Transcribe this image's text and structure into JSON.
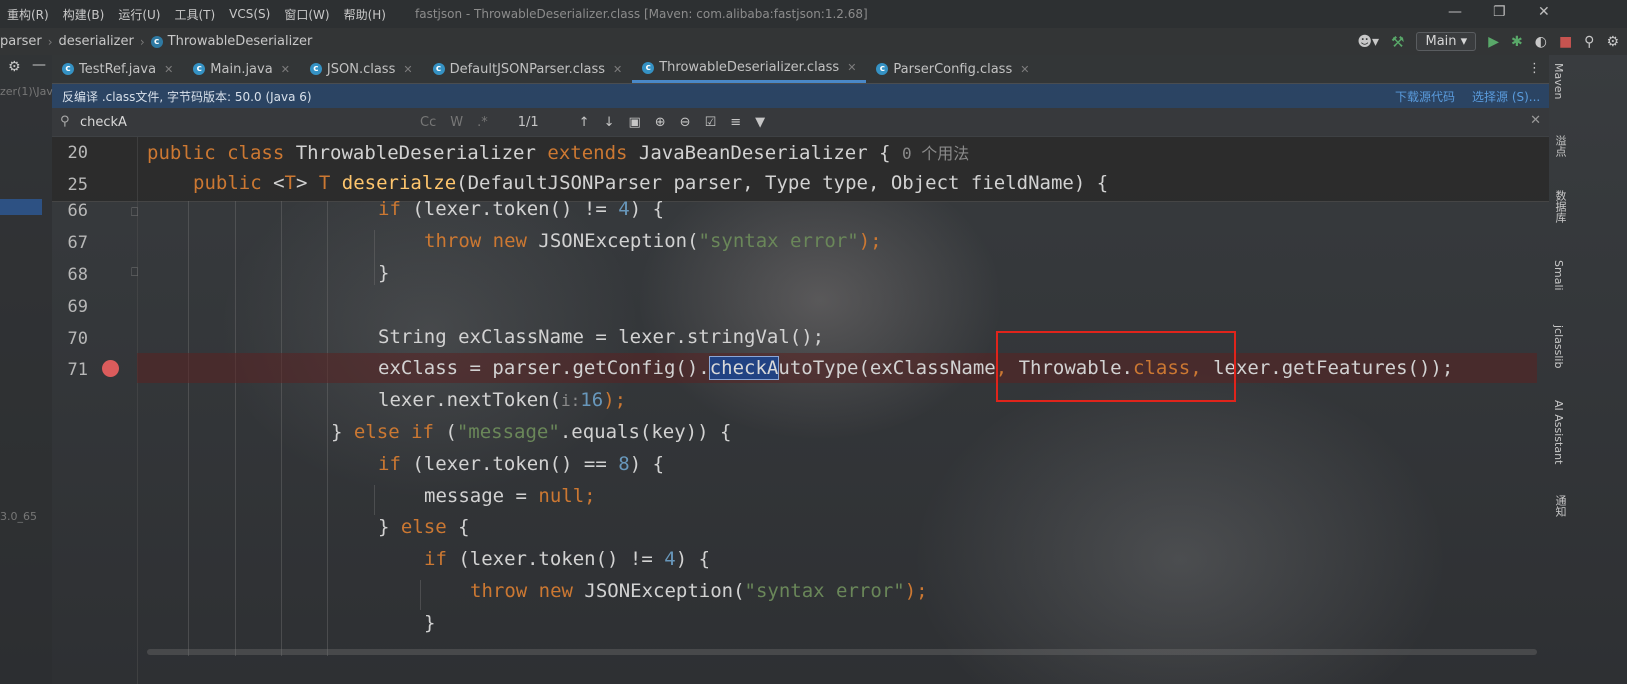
{
  "menu": {
    "items": [
      "重构(R)",
      "构建(B)",
      "运行(U)",
      "工具(T)",
      "VCS(S)",
      "窗口(W)",
      "帮助(H)"
    ],
    "title": "fastjson - ThrowableDeserializer.class [Maven: com.alibaba:fastjson:1.2.68]"
  },
  "nav": {
    "crumbs": [
      "parser",
      "deserializer",
      "ThrowableDeserializer"
    ],
    "run_config": "Main"
  },
  "tabs": [
    {
      "label": "TestRef.java"
    },
    {
      "label": "Main.java"
    },
    {
      "label": "JSON.class"
    },
    {
      "label": "DefaultJSONParser.class"
    },
    {
      "label": "ThrowableDeserializer.class"
    },
    {
      "label": "ParserConfig.class"
    }
  ],
  "banner": {
    "text": "反编译 .class文件, 字节码版本: 50.0 (Java 6)",
    "download_link": "下载源代码",
    "choose_link": "选择源 (S)..."
  },
  "search": {
    "query": "checkA",
    "match_count": "1/1"
  },
  "left_panel": {
    "text1": "zer(1)\\Jav",
    "text2": "3.0_65"
  },
  "right_tools": [
    "Maven",
    "溢点",
    "数据库",
    "Smali",
    "jclasslib",
    "AI Assistant",
    "通知"
  ],
  "code": {
    "sticky": [
      {
        "ln": "20",
        "class_decl": "ThrowableDeserializer",
        "super": "JavaBeanDeserializer",
        "usage_hint": "0 个用法"
      },
      {
        "ln": "25",
        "method": "deserialze",
        "params": "(DefaultJSONParser parser, Type type, Object fieldName) {"
      }
    ],
    "lines": [
      {
        "ln": "66"
      },
      {
        "ln": "67",
        "str": "\"syntax error\""
      },
      {
        "ln": "68"
      },
      {
        "ln": "69"
      },
      {
        "ln": "70",
        "text": "String exClassName = lexer.stringVal();"
      },
      {
        "ln": "71",
        "breakpoint": true,
        "pre": "exClass = parser.getConfig().",
        "match": "checkA",
        "post": "utoType(exClassName",
        "arg2": " Throwable.",
        "arg3": " lexer.getFeatures());"
      },
      {
        "ln": "",
        "text": "lexer.nextToken(",
        "hint": "i:",
        "num": "16"
      },
      {
        "ln": "",
        "str": "\"message\""
      },
      {
        "ln": "",
        "num": "8"
      },
      {
        "ln": "",
        "text": "message = "
      },
      {
        "ln": ""
      },
      {
        "ln": "",
        "num": "4"
      },
      {
        "ln": "",
        "str": "\"syntax error\""
      },
      {
        "ln": ""
      }
    ]
  },
  "colors": {
    "keyword": "#cc7832",
    "string": "#6a8759",
    "number": "#6897bb",
    "function": "#ffc66d",
    "annotation_box": "#e0241b",
    "breakpoint": "#db5c5c"
  }
}
